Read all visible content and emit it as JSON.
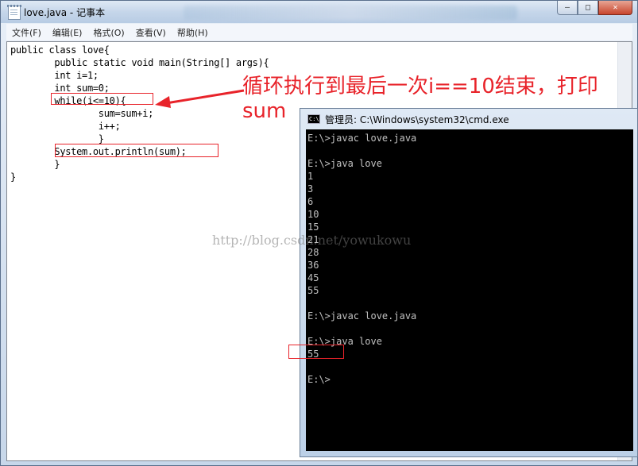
{
  "notepad": {
    "title": "love.java - 记事本",
    "menu": [
      "文件(F)",
      "编辑(E)",
      "格式(O)",
      "查看(V)",
      "帮助(H)"
    ],
    "code": [
      "public class love{",
      "        public static void main(String[] args){",
      "        int i=1;",
      "        int sum=0;",
      "        while(i<=10){",
      "                sum=sum+i;",
      "                i++;",
      "                }",
      "        System.out.println(sum);",
      "        }",
      "}"
    ]
  },
  "window_buttons": {
    "minimize": "—",
    "maximize": "□",
    "close": "✕"
  },
  "annotation": {
    "line1": "循环执行到最后一次i==10结束，打印",
    "line2": "sum"
  },
  "watermark": "http://blog.csdn.net/yowukowu",
  "cmd": {
    "icon_text": "C:\\",
    "title": "管理员: C:\\Windows\\system32\\cmd.exe",
    "lines": [
      "E:\\>javac love.java",
      "",
      "E:\\>java love",
      "1",
      "3",
      "6",
      "10",
      "15",
      "21",
      "28",
      "36",
      "45",
      "55",
      "",
      "",
      "E:\\>javac love.java",
      "",
      "E:\\>java love",
      "55",
      "",
      "E:\\>"
    ]
  }
}
